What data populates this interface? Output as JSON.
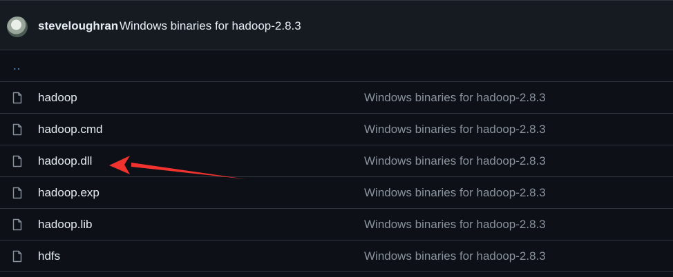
{
  "commit": {
    "author": "steveloughran",
    "message": "Windows binaries for hadoop-2.8.3"
  },
  "parent_link": "..",
  "files": [
    {
      "name": "hadoop",
      "commit_message": "Windows binaries for hadoop-2.8.3"
    },
    {
      "name": "hadoop.cmd",
      "commit_message": "Windows binaries for hadoop-2.8.3"
    },
    {
      "name": "hadoop.dll",
      "commit_message": "Windows binaries for hadoop-2.8.3"
    },
    {
      "name": "hadoop.exp",
      "commit_message": "Windows binaries for hadoop-2.8.3"
    },
    {
      "name": "hadoop.lib",
      "commit_message": "Windows binaries for hadoop-2.8.3"
    },
    {
      "name": "hdfs",
      "commit_message": "Windows binaries for hadoop-2.8.3"
    }
  ],
  "icons": {
    "file": "file-icon"
  },
  "colors": {
    "background": "#0d1117",
    "header_background": "#161b22",
    "border": "#30363d",
    "text": "#e6edf3",
    "muted_text": "#8b949e",
    "link": "#58a6ff",
    "annotation_arrow": "#f0332f"
  }
}
